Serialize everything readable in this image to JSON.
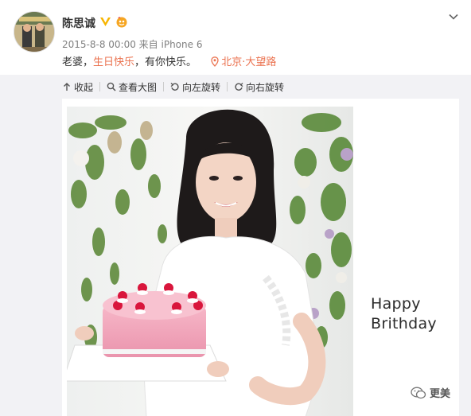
{
  "post": {
    "author": "陈思诚",
    "meta": "2015-8-8 00:00 来自 iPhone 6",
    "text_prefix": "老婆，",
    "text_link": "生日快乐",
    "text_suffix": "，有你快乐。",
    "location": "北京·大望路"
  },
  "toolbar": {
    "collapse": "收起",
    "view_large": "查看大图",
    "rotate_left": "向左旋转",
    "rotate_right": "向右旋转"
  },
  "image": {
    "greeting_line1": "Happy",
    "greeting_line2": "Brithday",
    "watermark": "更美"
  },
  "colors": {
    "link": "#eb7350",
    "verified": "#f7b500",
    "panel": "#f2f2f5"
  }
}
